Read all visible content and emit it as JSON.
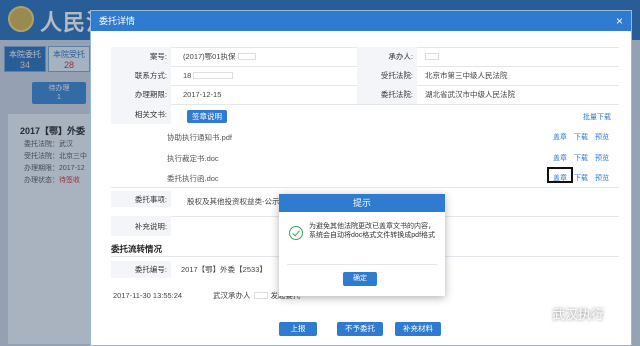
{
  "background": {
    "title": "人民法院执行案件管理系统",
    "tabs": [
      {
        "label": "本院委托",
        "count": "34"
      },
      {
        "label": "本院受托",
        "count": "28"
      }
    ],
    "pending": {
      "label": "待办理",
      "count": "1"
    },
    "case_title": "2017【鄂】外委【",
    "lines": [
      {
        "label": "委托法院：",
        "value": "武汉"
      },
      {
        "label": "受托法院：",
        "value": "北京三中"
      },
      {
        "label": "办理期限：",
        "value": "2017-12"
      },
      {
        "label": "办理状态：",
        "value": "待签收"
      }
    ]
  },
  "dialog": {
    "title": "委托详情",
    "close": "×",
    "fields": {
      "case_no_label": "案号:",
      "case_no_value": "(2017)鄂01执保",
      "handler_label": "承办人:",
      "contact_label": "联系方式:",
      "contact_value": "18",
      "entrusted_court_label": "受托法院:",
      "entrusted_court_value": "北京市第三中级人民法院",
      "deadline_label": "办理期限:",
      "deadline_value": "2017-12-15",
      "entrusting_court_label": "委托法院:",
      "entrusting_court_value": "湖北省武汉市中级人民法院",
      "docs_label": "相关文书:",
      "seal_desc_button": "签章说明",
      "batch_download": "批量下载",
      "matter_label": "委托事项:",
      "matter_value": "股权及其他投资权益类-公示冻结",
      "supplement_label": "补充说明:"
    },
    "documents": [
      {
        "name": "协助执行通知书.pdf",
        "actions": [
          "盖章",
          "下载",
          "预览"
        ]
      },
      {
        "name": "执行裁定书.doc",
        "actions": [
          "盖章",
          "下载",
          "预览"
        ]
      },
      {
        "name": "委托执行函.doc",
        "actions": [
          "盖章",
          "下载",
          "预览"
        ]
      }
    ],
    "flow": {
      "section_title": "委托流转情况",
      "entrust_no_label": "委托编号:",
      "entrust_no_value": "2017【鄂】外委【2533】",
      "log_time": "2017-11-30 13:55:24",
      "log_text": "武汉承办人",
      "log_text_tail": "发起委托"
    },
    "buttons": {
      "report": "上报",
      "reject": "不予委托",
      "supplement": "补充材料"
    }
  },
  "prompt": {
    "title": "提示",
    "message": "为避免其他法院更改已盖章文书的内容，系统会自动将doc格式文件转换成pdf格式",
    "ok": "确定"
  },
  "watermark": "武汉执行"
}
